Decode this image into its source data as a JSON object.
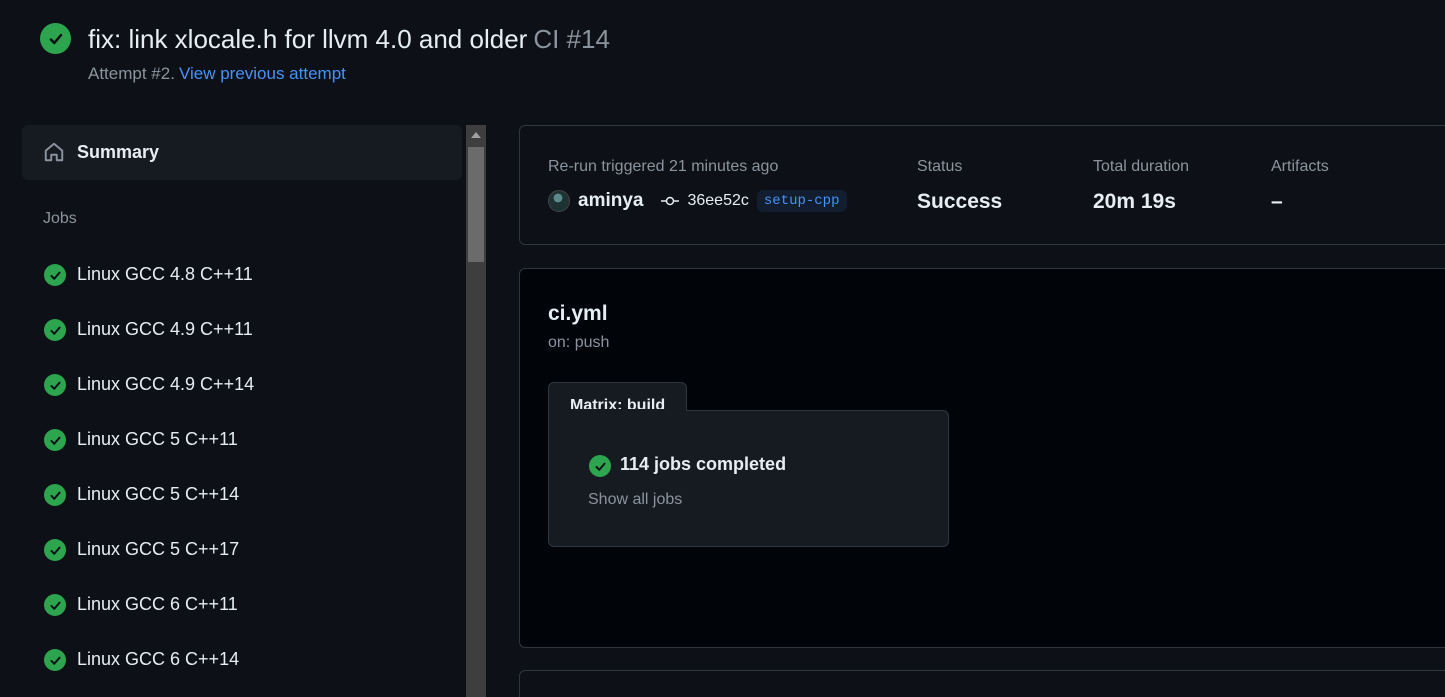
{
  "header": {
    "title": "fix: link xlocale.h for llvm 4.0 and older",
    "workflow_run": "CI #14",
    "attempt_text": "Attempt #2.",
    "previous_attempt_link": "View previous attempt"
  },
  "sidebar": {
    "summary_label": "Summary",
    "jobs_heading": "Jobs",
    "jobs": [
      {
        "label": "Linux GCC 4.8 C++11",
        "status": "success"
      },
      {
        "label": "Linux GCC 4.9 C++11",
        "status": "success"
      },
      {
        "label": "Linux GCC 4.9 C++14",
        "status": "success"
      },
      {
        "label": "Linux GCC 5 C++11",
        "status": "success"
      },
      {
        "label": "Linux GCC 5 C++14",
        "status": "success"
      },
      {
        "label": "Linux GCC 5 C++17",
        "status": "success"
      },
      {
        "label": "Linux GCC 6 C++11",
        "status": "success"
      },
      {
        "label": "Linux GCC 6 C++14",
        "status": "success"
      }
    ]
  },
  "run_info": {
    "trigger_label": "Re-run triggered 21 minutes ago",
    "actor": "aminya",
    "commit_sha": "36ee52c",
    "branch": "setup-cpp",
    "status_label": "Status",
    "status_value": "Success",
    "duration_label": "Total duration",
    "duration_value": "20m 19s",
    "artifacts_label": "Artifacts",
    "artifacts_value": "–"
  },
  "workflow_graph": {
    "file": "ci.yml",
    "trigger": "on: push",
    "matrix_label": "Matrix: build",
    "jobs_completed": "114 jobs completed",
    "show_all": "Show all jobs"
  },
  "colors": {
    "background": "#0d1117",
    "success": "#2da44e",
    "link": "#4493f8",
    "muted": "#8b949e"
  },
  "icons": {
    "status": "check-circle-icon",
    "summary": "home-icon",
    "commit": "git-commit-icon"
  }
}
